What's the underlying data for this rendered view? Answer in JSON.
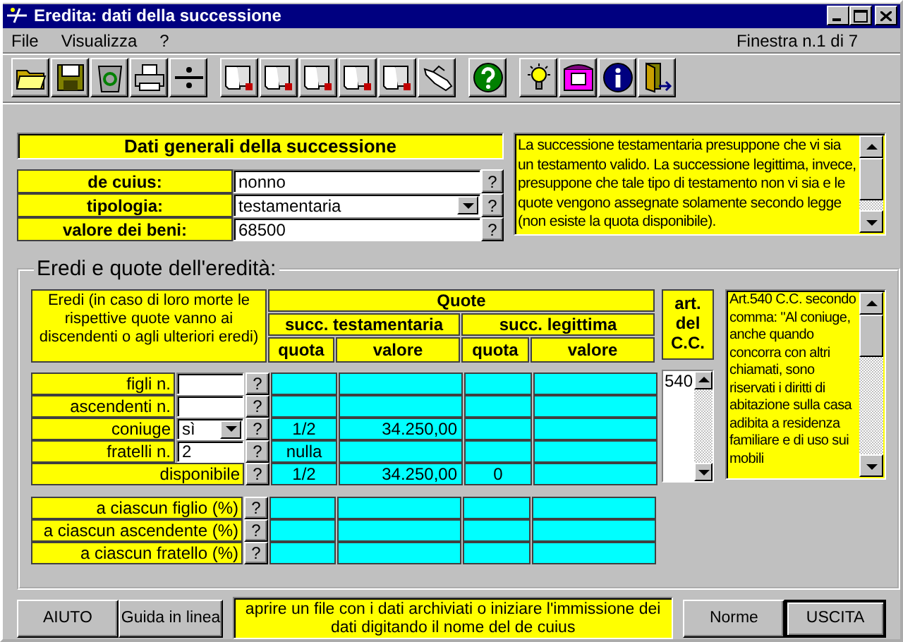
{
  "window": {
    "title": "Eredita: dati della successione"
  },
  "menu": [
    {
      "label": "File"
    },
    {
      "label": "Visualizza"
    },
    {
      "label": "?"
    }
  ],
  "window_counter": "Finestra n.1 di 7",
  "general": {
    "title": "Dati generali della successione",
    "fields": [
      {
        "label": "de cuius:",
        "value": "nonno",
        "kind": "text",
        "help": "?"
      },
      {
        "label": "tipologia:",
        "value": "testamentaria",
        "kind": "select",
        "help": "?"
      },
      {
        "label": "valore dei beni:",
        "value": "68500",
        "kind": "text",
        "help": "?"
      }
    ],
    "info": "La successione testamentaria presuppone che vi sia un testamento valido. La successione legittima, invece, presuppone che tale tipo di testamento non vi sia e le quote vengono assegnate solamente secondo legge (non esiste la quota disponibile)."
  },
  "heirs": {
    "title": "Eredi e quote dell'eredità:",
    "header": {
      "heirs": "Eredi (in caso di loro morte le rispettive quote vanno ai discendenti o agli ulteriori eredi)",
      "quote": "Quote",
      "testamentaria": "succ. testamentaria",
      "legittima": "succ. legittima",
      "columns": [
        "quota",
        "valore",
        "quota",
        "valore"
      ],
      "article": "art. del C.C."
    },
    "rows": [
      {
        "label": "figli n.",
        "kind": "text",
        "help": "?"
      },
      {
        "label": "ascendenti n.",
        "kind": "text",
        "help": "?"
      },
      {
        "label": "coniuge",
        "kind": "select",
        "value": "sì",
        "help": "?",
        "test_quota": "1/2",
        "test_valore": "34.250,00"
      },
      {
        "label": "fratelli n.",
        "kind": "text",
        "value": "2",
        "help": "?",
        "test_quota": "nulla"
      },
      {
        "label": "disponibile",
        "kind": "none",
        "help": "?",
        "test_quota": "1/2",
        "test_valore": "34.250,00",
        "leg_quota": "0"
      }
    ],
    "articles": [
      "540"
    ],
    "article_text": "Art.540 C.C. secondo comma: \"Al coniuge, anche quando concorra con altri chiamati, sono riservati i diritti di abitazione sulla casa adibita a residenza familiare e di uso sui mobili",
    "percent_rows": [
      {
        "label": "a ciascun figlio (%)",
        "help": "?"
      },
      {
        "label": "a ciascun ascendente (%)",
        "help": "?"
      },
      {
        "label": "a ciascun fratello (%)",
        "help": "?"
      }
    ]
  },
  "footer": {
    "left_buttons": [
      {
        "label": "AIUTO"
      },
      {
        "label": "Guida in linea"
      }
    ],
    "status": "aprire un file con i dati archiviati o iniziare l'immissione dei dati digitando il nome del de cuius",
    "right_buttons": [
      {
        "label": "Norme",
        "default": false
      },
      {
        "label": "USCITA",
        "default": true
      }
    ]
  }
}
